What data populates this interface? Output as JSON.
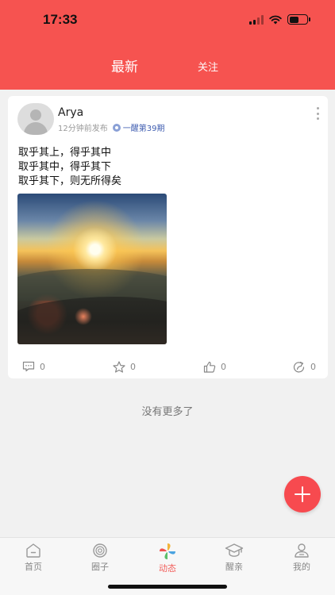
{
  "status_bar": {
    "time": "17:33"
  },
  "header": {
    "tabs": [
      {
        "label": "最新",
        "active": true
      },
      {
        "label": "关注",
        "active": false
      }
    ],
    "background_color": "#f65350"
  },
  "post": {
    "username": "Arya",
    "time_ago": "12分钟前发布",
    "circle": "一醒第39期",
    "content_lines": [
      "取乎其上，得乎其中",
      "取乎其中，得乎其下",
      "取乎其下，则无所得矣"
    ],
    "actions": {
      "comments": "0",
      "favorites": "0",
      "likes": "0",
      "shares": "0"
    }
  },
  "footer_text": "没有更多了",
  "bottom_nav": [
    {
      "label": "首页",
      "icon": "home-icon"
    },
    {
      "label": "圈子",
      "icon": "circle-icon"
    },
    {
      "label": "动态",
      "icon": "pinwheel-icon",
      "active": true
    },
    {
      "label": "醒亲",
      "icon": "graduation-cap-icon"
    },
    {
      "label": "我的",
      "icon": "user-icon"
    }
  ],
  "colors": {
    "accent": "#f74a4f",
    "active_nav": "#f25f5c"
  }
}
